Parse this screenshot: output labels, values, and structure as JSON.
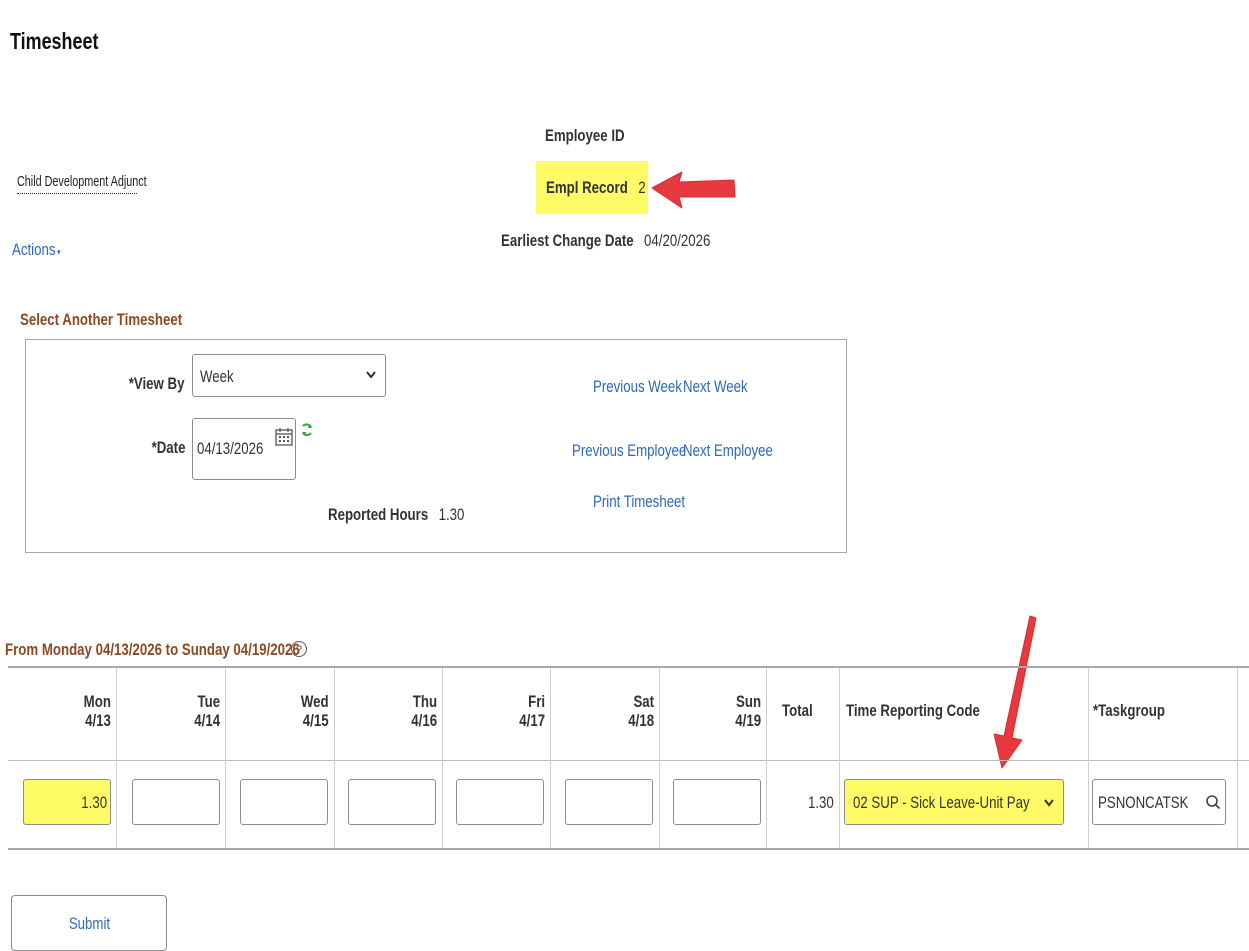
{
  "page": {
    "title": "Timesheet"
  },
  "employee": {
    "job_title": "Child Development Adjunct",
    "employee_id_label": "Employee ID",
    "empl_record_label": "Empl Record",
    "empl_record_value": "2",
    "earliest_change_label": "Earliest Change Date",
    "earliest_change_value": "04/20/2026"
  },
  "actions": {
    "label": "Actions",
    "caret": "▾"
  },
  "select_timesheet": {
    "heading": "Select Another Timesheet",
    "view_by_label": "*View By",
    "view_by_value": "Week",
    "date_label": "*Date",
    "date_value": "04/13/2026",
    "reported_hours_label": "Reported Hours",
    "reported_hours_value": "1.30",
    "links": {
      "previous_week": "Previous Week",
      "next_week": "Next Week",
      "previous_employee": "Previous Employee",
      "next_employee": "Next Employee",
      "print_timesheet": "Print Timesheet"
    }
  },
  "period": {
    "heading": "From Monday 04/13/2026 to Sunday 04/19/2026",
    "help_glyph": "?"
  },
  "grid": {
    "days": [
      {
        "day": "Mon",
        "date": "4/13",
        "hours": "1.30"
      },
      {
        "day": "Tue",
        "date": "4/14",
        "hours": ""
      },
      {
        "day": "Wed",
        "date": "4/15",
        "hours": ""
      },
      {
        "day": "Thu",
        "date": "4/16",
        "hours": ""
      },
      {
        "day": "Fri",
        "date": "4/17",
        "hours": ""
      },
      {
        "day": "Sat",
        "date": "4/18",
        "hours": ""
      },
      {
        "day": "Sun",
        "date": "4/19",
        "hours": ""
      }
    ],
    "total_label": "Total",
    "total_value": "1.30",
    "trc_label": "Time Reporting Code",
    "trc_value": "02 SUP - Sick Leave-Unit Pay",
    "taskgroup_label": "*Taskgroup",
    "taskgroup_value": "PSNONCATSK"
  },
  "submit": {
    "label": "Submit"
  },
  "chevron_glyph": "⌄",
  "icons": [
    "calendar-icon",
    "refresh-icon",
    "help-icon",
    "search-icon",
    "chevron-down-icon",
    "annotation-arrow"
  ],
  "colors": {
    "link": "#2d6ab6",
    "section_heading": "#8b4a23",
    "highlight": "#fffb66",
    "annotation_arrow": "#e8393f"
  }
}
